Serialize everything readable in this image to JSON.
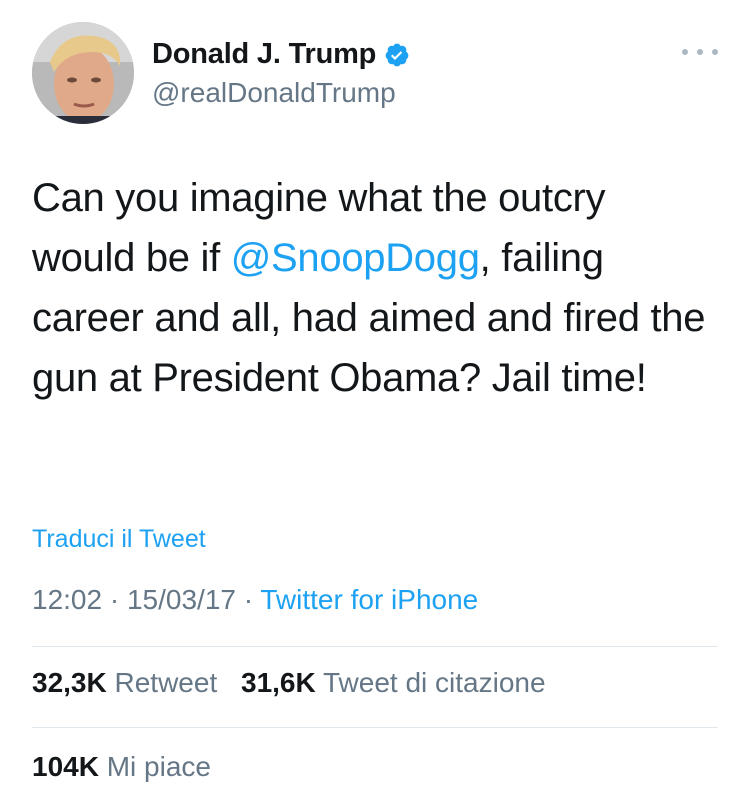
{
  "user": {
    "display_name": "Donald J. Trump",
    "handle": "@realDonaldTrump",
    "verified": true,
    "avatar_icon": "profile-photo"
  },
  "tweet": {
    "text_before": "Can you imagine what the outcry would be if ",
    "mention": "@SnoopDogg",
    "text_after": ", failing career and all, had aimed and fired the gun at President Obama? Jail time!"
  },
  "translate_label": "Traduci il Tweet",
  "meta": {
    "time": "12:02",
    "date": "15/03/17",
    "separator": "·",
    "source": "Twitter for iPhone"
  },
  "stats": {
    "retweets_count": "32,3K",
    "retweets_label": "Retweet",
    "quotes_count": "31,6K",
    "quotes_label": "Tweet di citazione",
    "likes_count": "104K",
    "likes_label": "Mi piace"
  },
  "colors": {
    "accent": "#1da1f2",
    "secondary_text": "#657786",
    "primary_text": "#14171a",
    "divider": "#e1e8ed"
  },
  "icons": {
    "verified": "verified-badge-icon",
    "more": "more-options-icon"
  }
}
